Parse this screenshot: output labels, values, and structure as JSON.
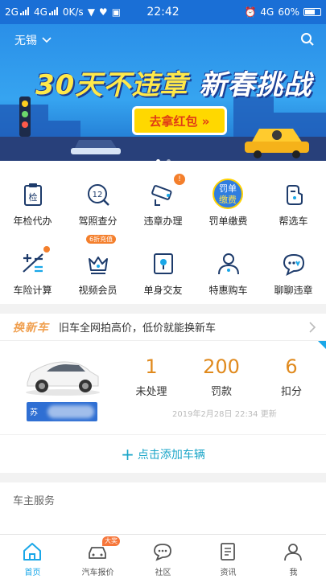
{
  "status_bar": {
    "network_left": "2G",
    "network_mid": "4G",
    "speed": "0K/s",
    "time": "22:42",
    "network_right": "4G",
    "battery": "60%"
  },
  "banner": {
    "city": "无锡",
    "title_main": "30天不违章",
    "title_sub": "新春挑战",
    "button_label": "去拿红包 »",
    "page_count": 2,
    "active_page": 1
  },
  "services": [
    {
      "label": "年检代办",
      "icon": "annual-inspection-icon"
    },
    {
      "label": "驾照查分",
      "icon": "license-points-icon"
    },
    {
      "label": "违章办理",
      "icon": "violation-camera-icon",
      "badge": "!"
    },
    {
      "label": "罚单缴费",
      "icon": "fine-payment-icon"
    },
    {
      "label": "帮选车",
      "icon": "car-help-icon"
    },
    {
      "label": "车险计算",
      "icon": "insurance-calc-icon",
      "dot": true
    },
    {
      "label": "视频会员",
      "icon": "video-vip-icon",
      "tag": "6折充值"
    },
    {
      "label": "单身交友",
      "icon": "dating-icon"
    },
    {
      "label": "特惠购车",
      "icon": "car-purchase-icon"
    },
    {
      "label": "聊聊违章",
      "icon": "chat-violation-icon"
    }
  ],
  "fine_icon_text": {
    "line1": "罚单",
    "line2": "缴费"
  },
  "license_icon_text": "12",
  "inspection_icon_text": "检",
  "promo": {
    "logo": "换新车",
    "text": "旧车全网拍高价，低价就能换新车"
  },
  "car_card": {
    "plate_prefix": "苏",
    "stats": [
      {
        "value": "1",
        "label": "未处理"
      },
      {
        "value": "200",
        "label": "罚款"
      },
      {
        "value": "6",
        "label": "扣分"
      }
    ],
    "update_time": "2019年2月28日 22:34 更新"
  },
  "add_car": {
    "label": "点击添加车辆"
  },
  "owner_services": {
    "title": "车主服务"
  },
  "tabbar": [
    {
      "label": "首页",
      "icon": "home-icon",
      "active": true
    },
    {
      "label": "汽车报价",
      "icon": "car-quote-icon",
      "badge": "大奖"
    },
    {
      "label": "社区",
      "icon": "community-icon"
    },
    {
      "label": "资讯",
      "icon": "news-icon"
    },
    {
      "label": "我",
      "icon": "profile-icon"
    }
  ],
  "colors": {
    "status_bar": "#1a6fd6",
    "accent": "#1aa7e8",
    "orange": "#e08a1e",
    "badge": "#f47f2c",
    "banner_button": "#ffd800"
  }
}
